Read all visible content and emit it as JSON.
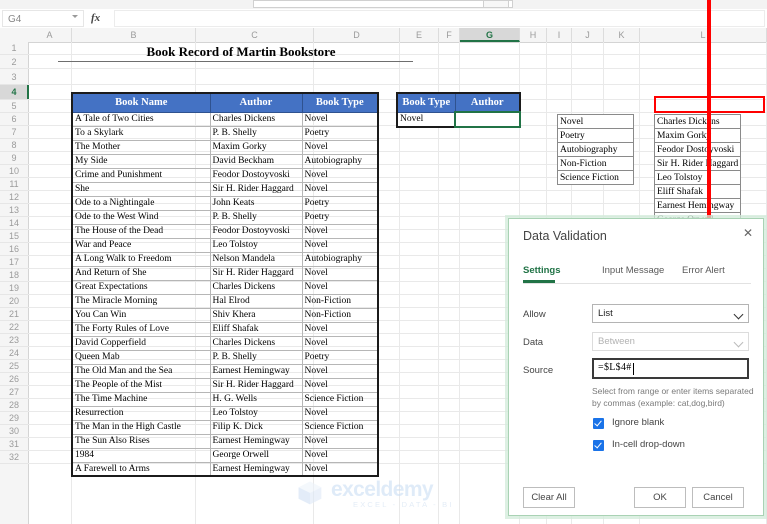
{
  "app": {
    "name_box": "G4",
    "formula_bar_value": "",
    "fx_label": "fx"
  },
  "grid": {
    "columns": [
      "A",
      "B",
      "C",
      "D",
      "E",
      "F",
      "G",
      "H",
      "I",
      "J",
      "K",
      "L"
    ],
    "selected_column": "G",
    "selected_row": 4,
    "rows": [
      1,
      2,
      3,
      4,
      5,
      6,
      7,
      8,
      9,
      10,
      11,
      12,
      13,
      14,
      15,
      16,
      17,
      18,
      19,
      20,
      21,
      22,
      23,
      24,
      25,
      26,
      27,
      28,
      29,
      30,
      31,
      32
    ]
  },
  "sheet": {
    "title": "Book Record of Martin Bookstore",
    "book_table": {
      "headers": [
        "Book Name",
        "Author",
        "Book Type"
      ],
      "rows": [
        [
          "A Tale of Two Cities",
          "Charles Dickens",
          "Novel"
        ],
        [
          "To a Skylark",
          "P. B. Shelly",
          "Poetry"
        ],
        [
          "The Mother",
          "Maxim Gorky",
          "Novel"
        ],
        [
          "My Side",
          "David Beckham",
          "Autobiography"
        ],
        [
          "Crime and Punishment",
          "Feodor Dostoyvoski",
          "Novel"
        ],
        [
          "She",
          "Sir H. Rider Haggard",
          "Novel"
        ],
        [
          "Ode to a Nightingale",
          "John Keats",
          "Poetry"
        ],
        [
          "Ode to the West Wind",
          "P. B. Shelly",
          "Poetry"
        ],
        [
          "The House of the Dead",
          "Feodor Dostoyvoski",
          "Novel"
        ],
        [
          "War and Peace",
          "Leo Tolstoy",
          "Novel"
        ],
        [
          "A Long Walk to Freedom",
          "Nelson Mandela",
          "Autobiography"
        ],
        [
          "And Return of She",
          "Sir H. Rider Haggard",
          "Novel"
        ],
        [
          "Great Expectations",
          "Charles Dickens",
          "Novel"
        ],
        [
          "The Miracle Morning",
          "Hal Elrod",
          "Non-Fiction"
        ],
        [
          "You Can Win",
          "Shiv Khera",
          "Non-Fiction"
        ],
        [
          "The Forty Rules of Love",
          "Eliff Shafak",
          "Novel"
        ],
        [
          "David Copperfield",
          "Charles Dickens",
          "Novel"
        ],
        [
          "Queen Mab",
          "P. B. Shelly",
          "Poetry"
        ],
        [
          "The Old Man and the Sea",
          "Earnest Hemingway",
          "Novel"
        ],
        [
          "The People of the Mist",
          "Sir H. Rider Haggard",
          "Novel"
        ],
        [
          "The Time Machine",
          "H. G. Wells",
          "Science Fiction"
        ],
        [
          "Resurrection",
          "Leo Tolstoy",
          "Novel"
        ],
        [
          "The Man in the High Castle",
          "Filip K. Dick",
          "Science Fiction"
        ],
        [
          "The Sun Also Rises",
          "Earnest Hemingway",
          "Novel"
        ],
        [
          "1984",
          "George Orwell",
          "Novel"
        ],
        [
          "A Farewell to Arms",
          "Earnest Hemingway",
          "Novel"
        ]
      ]
    },
    "lookup_table": {
      "headers": [
        "Book Type",
        "Author"
      ],
      "book_type_value": "Novel",
      "author_value": ""
    },
    "book_type_list": [
      "Novel",
      "Poetry",
      "Autobiography",
      "Non-Fiction",
      "Science Fiction"
    ],
    "author_list": [
      "Charles Dickens",
      "Maxim Gorky",
      "Feodor Dostoyvoski",
      "Sir H. Rider Haggard",
      "Leo Tolstoy",
      "Eliff Shafak",
      "Earnest Hemingway",
      "George Orwell"
    ]
  },
  "dialog": {
    "title": "Data Validation",
    "close_label": "✕",
    "tabs": [
      {
        "label": "Settings",
        "active": true
      },
      {
        "label": "Input Message",
        "active": false
      },
      {
        "label": "Error Alert",
        "active": false
      }
    ],
    "allow_label": "Allow",
    "allow_value": "List",
    "data_label": "Data",
    "data_value": "Between",
    "source_label": "Source",
    "source_value": "=$L$4#",
    "hint_line1": "Select from range or enter items separated",
    "hint_line2": "by commas (example: cat,dog,bird)",
    "ignore_blank_label": "Ignore blank",
    "ignore_blank_checked": true,
    "incell_dropdown_label": "In-cell drop-down",
    "incell_dropdown_checked": true,
    "clear_all_label": "Clear All",
    "ok_label": "OK",
    "cancel_label": "Cancel"
  },
  "annotation": {
    "highlight_color": "#ff0000"
  },
  "watermark": {
    "name": "exceldemy",
    "tagline": "EXCEL - DATA - BI"
  },
  "theme": {
    "header_blue": "#4472c4",
    "excel_green": "#217346",
    "annotation_red": "#ff0000",
    "checkbox_blue": "#1a73e8"
  }
}
